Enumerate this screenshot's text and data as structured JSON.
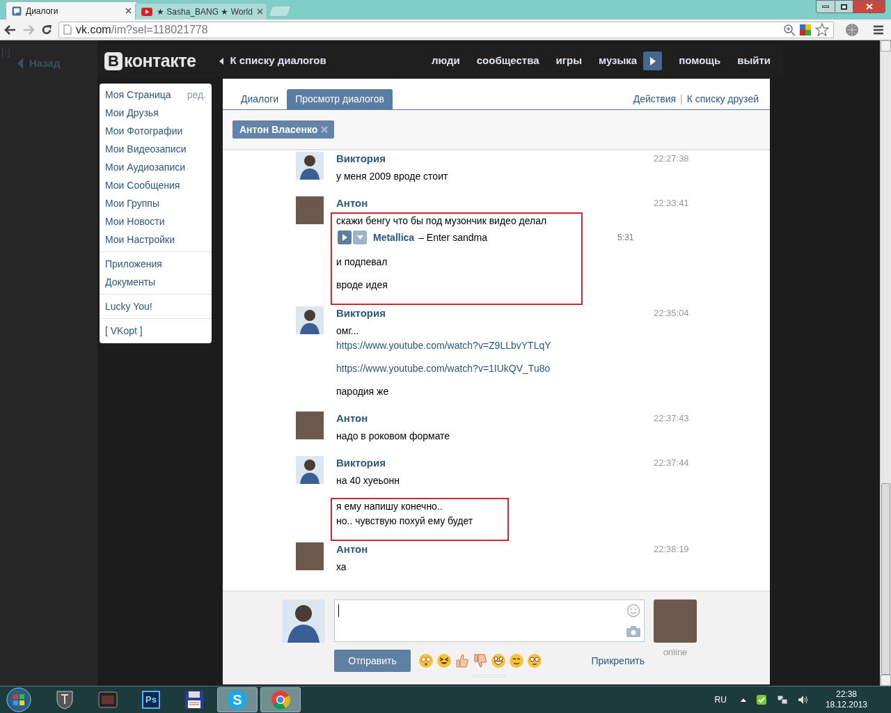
{
  "browser": {
    "tabs": [
      {
        "title": "Диалоги",
        "selected": true,
        "favicon": {
          "kind": "chat"
        }
      },
      {
        "title": "★ Sasha_BANG ★ World",
        "selected": false,
        "favicon": {
          "kind": "video"
        }
      }
    ],
    "address": {
      "host": "vk.com",
      "path": "/im?sel=118021778"
    }
  },
  "page_side": {
    "up_link": "[↑]",
    "back_link": "Назад"
  },
  "header": {
    "logo_mark": "В",
    "logo_text": "контакте",
    "back_link": "К списку диалогов",
    "nav": [
      {
        "label": "люди"
      },
      {
        "label": "сообщества"
      },
      {
        "label": "игры"
      },
      {
        "label": "музыка",
        "player": true
      },
      {
        "label": "помощь"
      },
      {
        "label": "выйти"
      }
    ]
  },
  "sidebar": {
    "groups": [
      [
        {
          "label": "Моя Страница",
          "extra": "ред."
        },
        {
          "label": "Мои Друзья"
        },
        {
          "label": "Мои Фотографии"
        },
        {
          "label": "Мои Видеозаписи"
        },
        {
          "label": "Мои Аудиозаписи"
        },
        {
          "label": "Мои Сообщения"
        },
        {
          "label": "Мои Группы"
        },
        {
          "label": "Мои Новости"
        },
        {
          "label": "Мои Настройки"
        }
      ],
      [
        {
          "label": "Приложения"
        },
        {
          "label": "Документы"
        }
      ],
      [
        {
          "label": "Lucky You!"
        }
      ],
      [
        {
          "label": "[ VKopt ]"
        }
      ]
    ]
  },
  "tabs": [
    {
      "label": "Диалоги",
      "selected": false
    },
    {
      "label": "Просмотр диалогов",
      "selected": true
    }
  ],
  "actions": [
    "Действия",
    "|",
    "К списку друзей"
  ],
  "recipient_chip": "Антон Власенко",
  "messages": [
    {
      "sender": "Виктория",
      "time": "22:27:38",
      "avatar": {
        "kind": "drawing"
      },
      "groups": [
        {
          "boxed": false,
          "parts": [
            [
              {
                "kind": "text",
                "text": "у меня 2009 вроде стоит"
              }
            ]
          ]
        }
      ]
    },
    {
      "sender": "Антон",
      "time": "22:33:41",
      "avatar": {
        "kind": "photo"
      },
      "groups": [
        {
          "boxed": true,
          "parts": [
            [
              {
                "kind": "text",
                "text": "скажи бенгу что бы под музончик видео делал"
              },
              {
                "kind": "audio",
                "artist": "Metallica",
                "title": "– Enter sandma",
                "duration": "5:31"
              }
            ],
            [
              {
                "kind": "text",
                "text": "и подпевал"
              }
            ],
            [
              {
                "kind": "text",
                "text": "вроде идея"
              }
            ]
          ]
        }
      ]
    },
    {
      "sender": "Виктория",
      "time": "22:35:04",
      "avatar": {
        "kind": "drawing"
      },
      "groups": [
        {
          "boxed": false,
          "parts": [
            [
              {
                "kind": "text",
                "text": "омг..."
              },
              {
                "kind": "link",
                "text": "https://www.youtube.com/watch?v=Z9LLbvYTLqY"
              }
            ],
            [
              {
                "kind": "link",
                "text": "https://www.youtube.com/watch?v=1IUkQV_Tu8o"
              }
            ],
            [
              {
                "kind": "text",
                "text": "пародия же"
              }
            ]
          ]
        }
      ]
    },
    {
      "sender": "Антон",
      "time": "22:37:43",
      "avatar": {
        "kind": "photo"
      },
      "groups": [
        {
          "boxed": false,
          "parts": [
            [
              {
                "kind": "text",
                "text": "надо в роковом формате"
              }
            ]
          ]
        }
      ]
    },
    {
      "sender": "Виктория",
      "time": "22:37:44",
      "avatar": {
        "kind": "drawing"
      },
      "groups": [
        {
          "boxed": false,
          "parts": [
            [
              {
                "kind": "text",
                "text": "на 40 хуеьонн"
              }
            ]
          ]
        },
        {
          "boxed": true,
          "parts": [
            [
              {
                "kind": "text",
                "text": "я ему напишу конечно.."
              },
              {
                "kind": "text",
                "text": "но.. чувствую похуй ему будет"
              }
            ]
          ]
        }
      ]
    },
    {
      "sender": "Антон",
      "time": "22:38:19",
      "avatar": {
        "kind": "photo"
      },
      "groups": [
        {
          "boxed": false,
          "parts": [
            [
              {
                "kind": "text",
                "text": "ха"
              }
            ]
          ]
        }
      ]
    }
  ],
  "composer": {
    "send_button": "Отправить",
    "attach_link": "Прикрепить",
    "peer_status": "online"
  },
  "taskbar": {
    "apps": [
      {
        "kind": "tanks",
        "active": false
      },
      {
        "kind": "media",
        "active": false
      },
      {
        "kind": "ps",
        "active": false
      },
      {
        "kind": "floppy",
        "active": false
      },
      {
        "kind": "skype",
        "active": true
      },
      {
        "kind": "chrome",
        "active": true
      }
    ],
    "ps_label": "Ps",
    "skype_label": "S",
    "language": "RU",
    "time": "22:38",
    "date": "18.12.2013"
  }
}
